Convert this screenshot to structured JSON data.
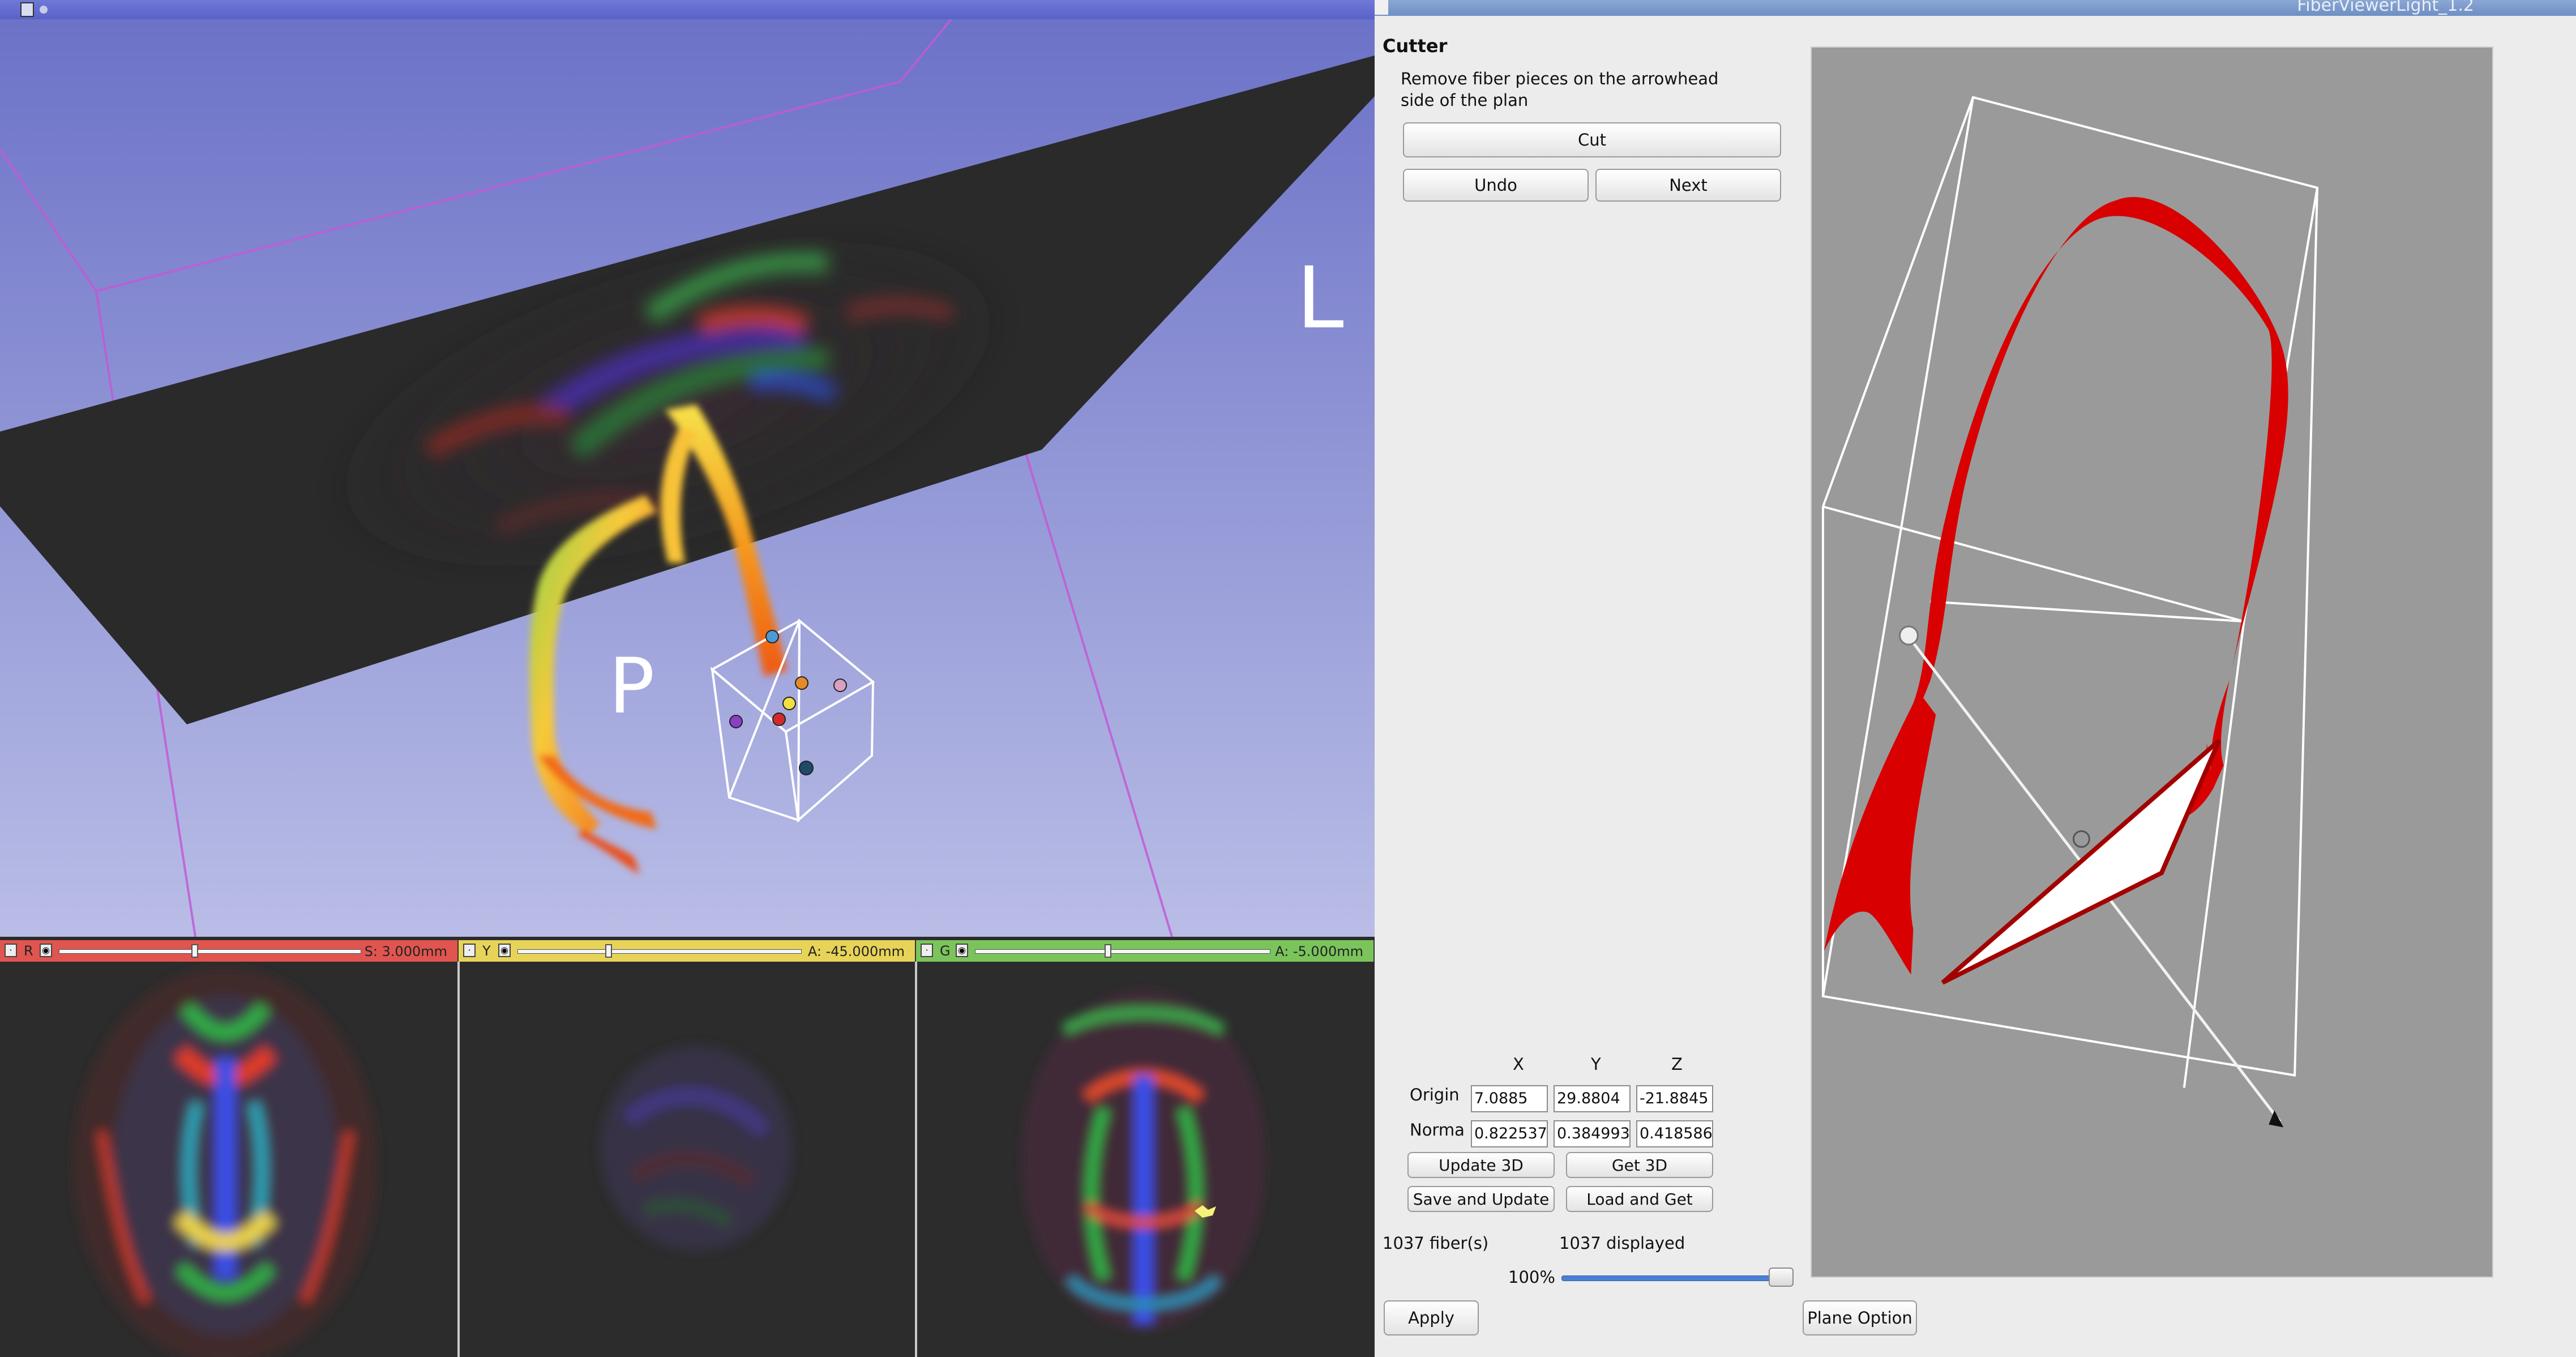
{
  "viewer3d": {
    "orientation_labels": {
      "left": "L",
      "posterior": "P"
    },
    "slices": [
      {
        "letter": "R",
        "color": "#e0554f",
        "value": "S: 3.000mm",
        "knob_fraction": 0.45
      },
      {
        "letter": "Y",
        "color": "#e7d358",
        "value": "A: -45.000mm",
        "knob_fraction": 0.32
      },
      {
        "letter": "G",
        "color": "#7bc45c",
        "value": "A: -5.000mm",
        "knob_fraction": 0.45
      }
    ]
  },
  "dialog": {
    "title": "FiberViewerLight_1.2",
    "section_title": "Cutter",
    "description": "Remove fiber pieces on the arrowhead side of the plan",
    "buttons": {
      "cut": "Cut",
      "undo": "Undo",
      "next": "Next",
      "update_3d": "Update 3D",
      "get_3d": "Get 3D",
      "save_and_update": "Save and Update",
      "load_and_get": "Load and Get",
      "apply": "Apply",
      "plane_option": "Plane Option"
    },
    "axes": [
      "X",
      "Y",
      "Z"
    ],
    "origin": {
      "label": "Origin",
      "x": "7.0885",
      "y": "29.8804",
      "z": "-21.8845"
    },
    "normal": {
      "label": "Norma",
      "x": "0.822537",
      "y": "0.384993",
      "z": "0.418586"
    },
    "fiber_count": "1037 fiber(s)",
    "displayed_count": "1037 displayed",
    "percent_label": "100%",
    "percent_value": 100
  }
}
